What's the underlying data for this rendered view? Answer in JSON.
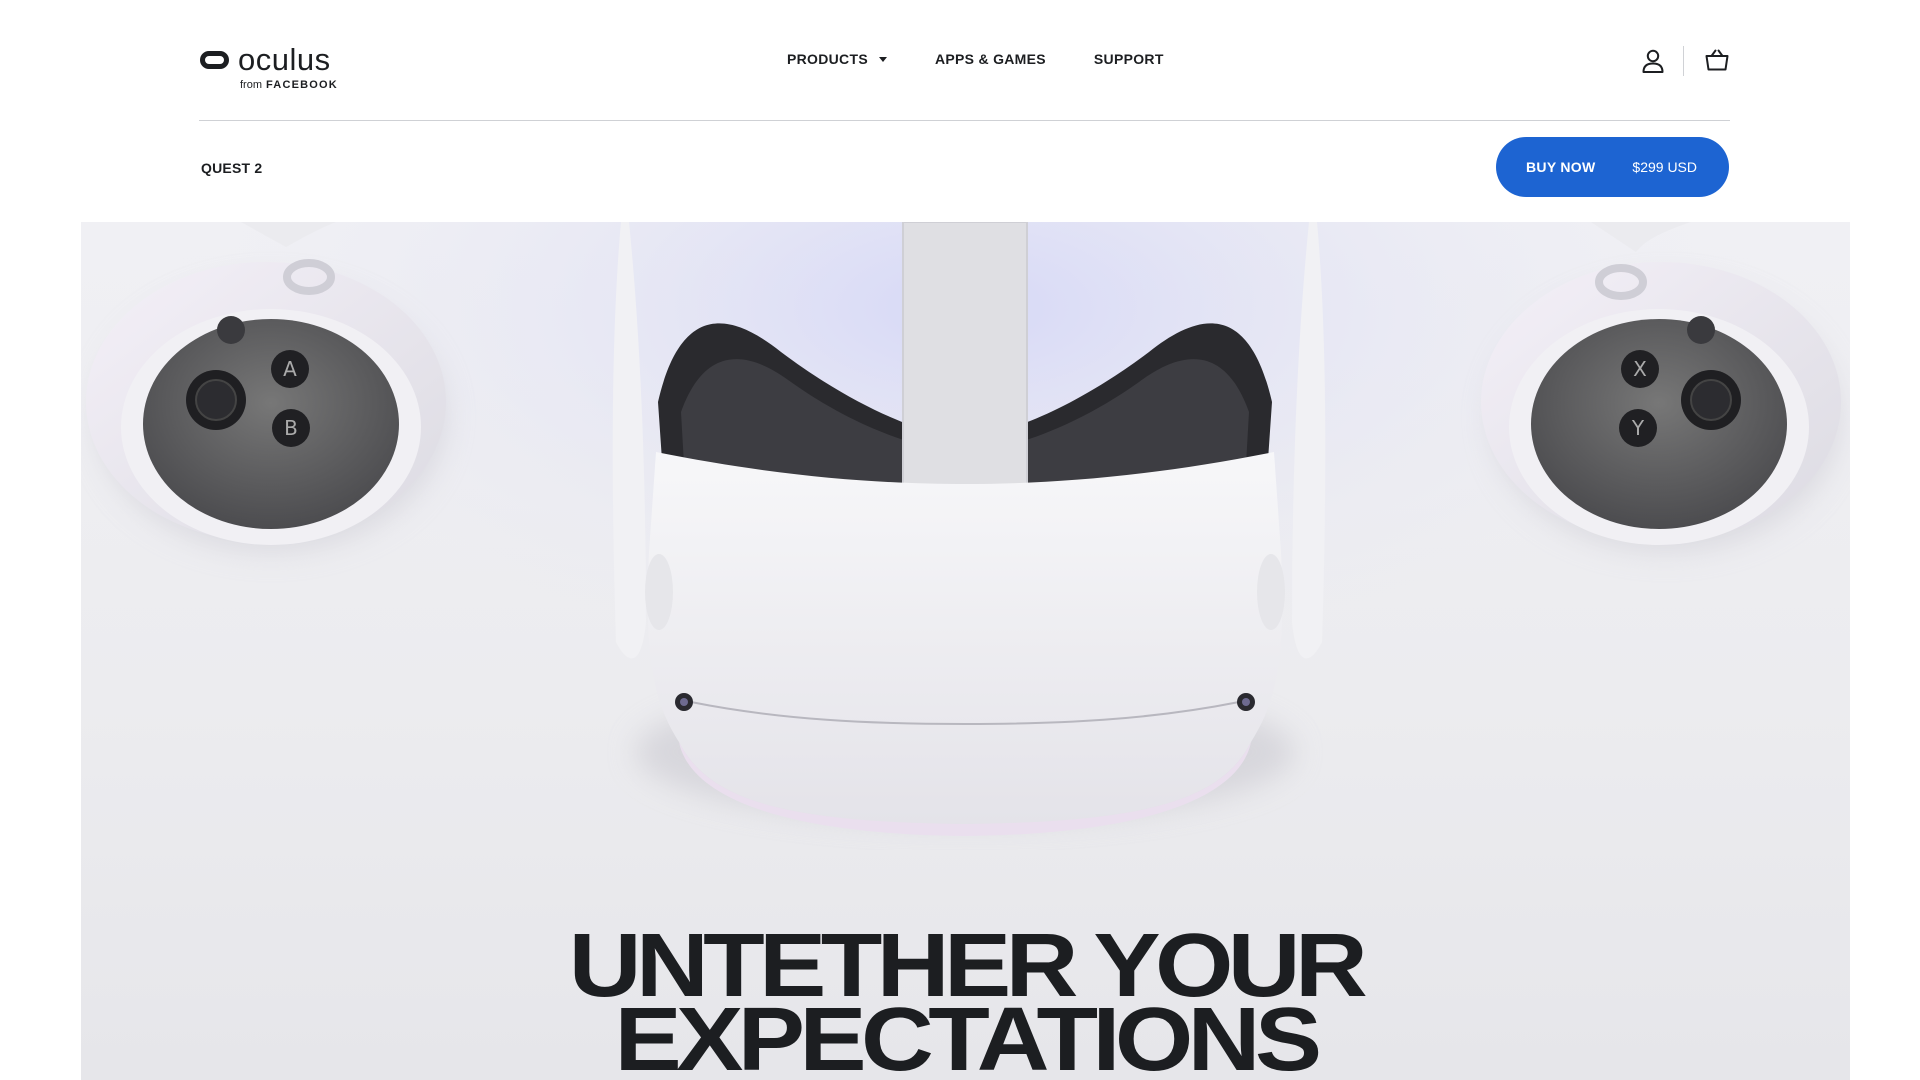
{
  "brand": {
    "name": "oculus",
    "from_label": "from",
    "parent": "FACEBOOK"
  },
  "nav": {
    "items": [
      {
        "label": "PRODUCTS",
        "has_dropdown": true
      },
      {
        "label": "APPS & GAMES",
        "has_dropdown": false
      },
      {
        "label": "SUPPORT",
        "has_dropdown": false
      }
    ]
  },
  "header_icons": [
    "account-icon",
    "cart-icon"
  ],
  "product_bar": {
    "title": "QUEST 2",
    "buy_label": "BUY NOW",
    "price": "$299 USD"
  },
  "hero": {
    "headline_line1": "UNTETHER YOUR",
    "headline_line2": "EXPECTATIONS",
    "imagery": [
      "left-touch-controller",
      "quest-2-headset",
      "right-touch-controller"
    ]
  },
  "colors": {
    "accent": "#1d64d2",
    "text": "#1c1e21",
    "hero_background": "#ececef"
  }
}
